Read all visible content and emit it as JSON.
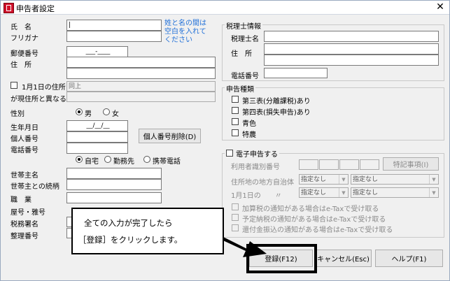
{
  "window": {
    "title": "申告者設定",
    "close_glyph": "✕"
  },
  "left": {
    "name_label": "氏　名",
    "furigana_label": "フリガナ",
    "name_hint": "姓と名の間は\n空白を入れて\nください",
    "postal_label": "郵便番号",
    "postal_value": "___-____",
    "address_label": "住　所",
    "jan1_check_label": "1月1日の住所",
    "jan1_check_label2": "が現住所と異なる",
    "jan1_value": "同上",
    "gender_label": "性別",
    "gender_options": [
      "男",
      "女"
    ],
    "birth_label": "生年月日",
    "birth_value": "__/__/__",
    "mynumber_label": "個人番号",
    "mynumber_delete_button": "個人番号削除(D)",
    "phone_label": "電話番号",
    "phone_options": [
      "自宅",
      "勤務先",
      "携帯電話"
    ],
    "household_label": "世帯主名",
    "household_rel_label": "世帯主との続柄",
    "job_label": "職　業",
    "shop_label": "屋号・雅号",
    "taxoffice_label": "税務署名",
    "serial_label": "整理番号"
  },
  "taxacc": {
    "group_title": "税理士情報",
    "name_label": "税理士名",
    "address_label": "住　所",
    "phone_label": "電話番号"
  },
  "kind": {
    "group_title": "申告種類",
    "items": [
      "第三表(分離課税)あり",
      "第四表(損失申告)あり",
      "青色",
      "特農"
    ]
  },
  "etax": {
    "group_title": "電子申告する",
    "user_id_label": "利用者識別番号",
    "special_button": "特記事項(I)",
    "local_gov_label": "住所地の地方自治体",
    "jan1_label": "1月1日の　　〃",
    "select_value": "指定なし",
    "notices": [
      "加算税の通知がある場合はe-Taxで受け取る",
      "予定納税の通知がある場合はe-Taxで受け取る",
      "還付金振込の通知がある場合はe-Taxで受け取る"
    ]
  },
  "callout": {
    "line1": "全ての入力が完了したら",
    "line2": "［登録］をクリックします。"
  },
  "buttons": {
    "register": "登録(F12)",
    "cancel": "キャンセル(Esc)",
    "help": "ヘルプ(F1)"
  }
}
